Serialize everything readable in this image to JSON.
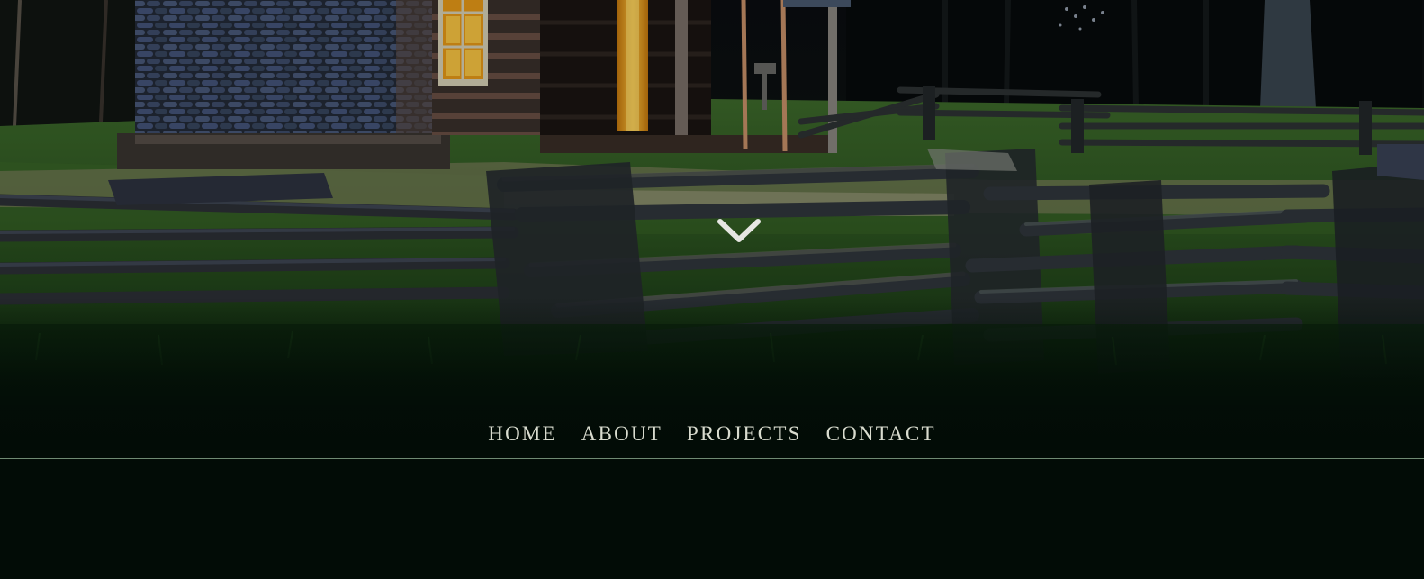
{
  "nav": {
    "items": [
      {
        "label": "HOME"
      },
      {
        "label": "ABOUT"
      },
      {
        "label": "PROJECTS"
      },
      {
        "label": "CONTACT"
      }
    ]
  },
  "hero": {
    "scroll_icon": "chevron-down-icon"
  },
  "colors": {
    "background": "#020c06",
    "nav_text": "#d9dccf",
    "nav_rule": "#6f8a72",
    "window_glow": "#f2a81c"
  }
}
